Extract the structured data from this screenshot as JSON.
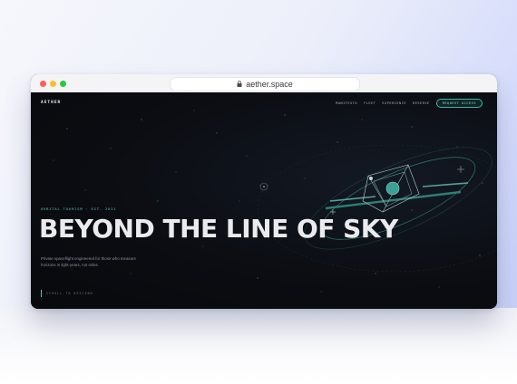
{
  "browser": {
    "url": "aether.space",
    "controls": [
      "close",
      "minimize",
      "maximize"
    ],
    "lock_icon": "lock-icon"
  },
  "site": {
    "logo": "AETHER",
    "nav": {
      "links": [
        "MANIFESTO",
        "FLEET",
        "EXPERIENCE",
        "RESERVE"
      ],
      "cta": "REQUEST ACCESS"
    },
    "hero": {
      "kicker": "ORBITAL TOURISM · EST. 2031",
      "headline": "BEYOND THE LINE OF SKY",
      "tagline": "Private spaceflight engineered for those who measure horizons in light-years, not miles.",
      "scroll_hint": "SCROLL TO DESCEND"
    }
  },
  "colors": {
    "page_background": "#0b0d12",
    "accent": "#4ec9b8",
    "headline": "#e9ebef",
    "desktop_gradient_end": "#c5cdf8"
  }
}
